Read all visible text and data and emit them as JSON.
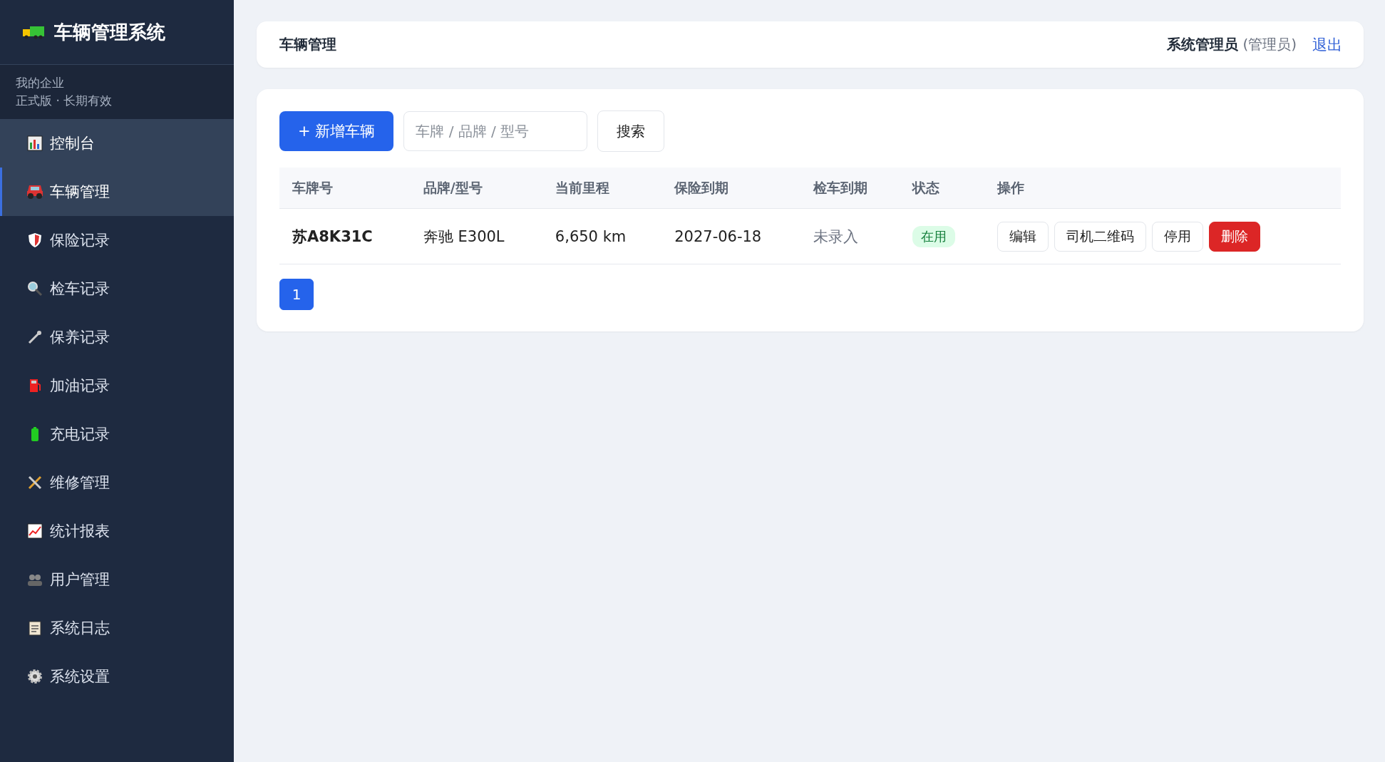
{
  "sidebar": {
    "title": "车辆管理系统",
    "org": "我的企业",
    "plan": "正式版 · 长期有效",
    "items": [
      {
        "label": "控制台",
        "selected": false,
        "hovered": true
      },
      {
        "label": "车辆管理",
        "selected": true,
        "hovered": false
      },
      {
        "label": "保险记录",
        "selected": false,
        "hovered": false
      },
      {
        "label": "检车记录",
        "selected": false,
        "hovered": false
      },
      {
        "label": "保养记录",
        "selected": false,
        "hovered": false
      },
      {
        "label": "加油记录",
        "selected": false,
        "hovered": false
      },
      {
        "label": "充电记录",
        "selected": false,
        "hovered": false
      },
      {
        "label": "维修管理",
        "selected": false,
        "hovered": false
      },
      {
        "label": "统计报表",
        "selected": false,
        "hovered": false
      },
      {
        "label": "用户管理",
        "selected": false,
        "hovered": false
      },
      {
        "label": "系统日志",
        "selected": false,
        "hovered": false
      },
      {
        "label": "系统设置",
        "selected": false,
        "hovered": false
      }
    ]
  },
  "header": {
    "title": "车辆管理",
    "user": "系统管理员",
    "role": "(管理员)",
    "logout": "退出"
  },
  "toolbar": {
    "add_button": "+ 新增车辆",
    "search": {
      "placeholder": "车牌 / 品牌 / 型号"
    },
    "search_button": "搜索"
  },
  "table": {
    "columns": [
      "车牌号",
      "品牌/型号",
      "当前里程",
      "保险到期",
      "检车到期",
      "状态",
      "操作"
    ],
    "rows": [
      {
        "plate": "苏A8K31C",
        "model": "奔驰 E300L",
        "mileage": "6,650 km",
        "insurance": "2027-06-18",
        "inspection": "未录入",
        "status": {
          "text": "在用",
          "kind": "active"
        },
        "actions": [
          {
            "label": "编辑",
            "kind": "default"
          },
          {
            "label": "司机二维码",
            "kind": "default"
          },
          {
            "label": "停用",
            "kind": "default"
          },
          {
            "label": "删除",
            "kind": "danger"
          }
        ]
      }
    ]
  },
  "pagination": [
    {
      "label": "1",
      "selected": true
    }
  ]
}
